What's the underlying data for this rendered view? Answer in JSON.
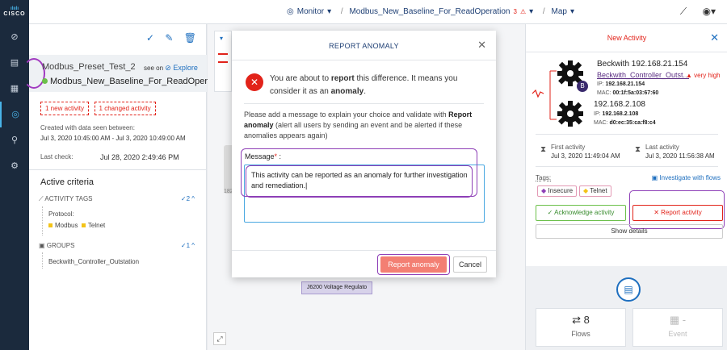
{
  "app": {
    "logo": "CISCO"
  },
  "breadcrumb": {
    "monitor": "Monitor",
    "baseline": "Modbus_New_Baseline_For_ReadOperation",
    "baseline_count": "3",
    "view": "Map"
  },
  "left_panel": {
    "preset": "Modbus_Preset_Test_2",
    "see_on": "see on",
    "explore": "Explore",
    "baseline": "Modbus_New_Baseline_For_ReadOperation",
    "new_activity": "1 new activity",
    "changed_activity": "1 changed activity",
    "created_label": "Created with data seen between:",
    "created_range": "Jul 3, 2020 10:45:00 AM - Jul 3, 2020 10:49:00 AM",
    "last_check_label": "Last check:",
    "last_check_value": "Jul 28, 2020 2:49:46 PM",
    "active_criteria": "Active criteria",
    "activity_tags_label": "ACTIVITY TAGS",
    "activity_tags_count": "2",
    "protocol_label": "Protocol:",
    "tags": [
      "Modbus",
      "Telnet"
    ],
    "groups_label": "GROUPS",
    "groups_count": "1",
    "group_item": "Beckwith_Controller_Outstation"
  },
  "canvas": {
    "node_label": "J6200 Voltage Regulato",
    "side_text": "182"
  },
  "modal": {
    "title": "REPORT ANOMALY",
    "lead_1": "You are about to ",
    "lead_bold_1": "report",
    "lead_2": " this difference. It means you consider it as an ",
    "lead_bold_2": "anomaly",
    "lead_3": ".",
    "desc_1": "Please add a message to explain your choice and validate with ",
    "desc_bold": "Report anomaly",
    "desc_2": " (alert all users by sending an event and be alerted if these anomalies appears again)",
    "message_label": "Message",
    "message_required": "*",
    "message_colon": " :",
    "message_value": "This activity can be reported as an anomaly for further investigation and remediation.",
    "report_button": "Report anomaly",
    "cancel_button": "Cancel"
  },
  "right_panel": {
    "title": "New Activity",
    "host1_name": "Beckwith 192.168.21.154",
    "host1_group": "Beckwith_Controller_Outst...",
    "host1_flag": "very high",
    "host1_ip_label": "IP:",
    "host1_ip": "192.168.21.154",
    "host1_mac_label": "MAC:",
    "host1_mac": "00:1f:5a:03:67:60",
    "host1_badge": "B",
    "host2_name": "192.168.2.108",
    "host2_ip_label": "IP:",
    "host2_ip": "192.168.2.108",
    "host2_mac_label": "MAC:",
    "host2_mac": "d0:ec:35:ca:f8:c4",
    "first_activity_label": "First activity",
    "first_activity_value": "Jul 3, 2020 11:49:04 AM",
    "last_activity_label": "Last activity",
    "last_activity_value": "Jul 3, 2020 11:56:38 AM",
    "tags_label": "Tags:",
    "investigate": "Investigate with flows",
    "tags": [
      "Insecure",
      "Telnet"
    ],
    "acknowledge": "Acknowledge activity",
    "report": "Report activity",
    "show_details": "Show details",
    "flows_count": "8",
    "flows_label": "Flows",
    "event_count": "-",
    "event_label": "Event"
  },
  "colors": {
    "danger": "#e2231a",
    "primary": "#1e6fbf",
    "highlight": "#8e3fb7",
    "success": "#6cc04a"
  }
}
